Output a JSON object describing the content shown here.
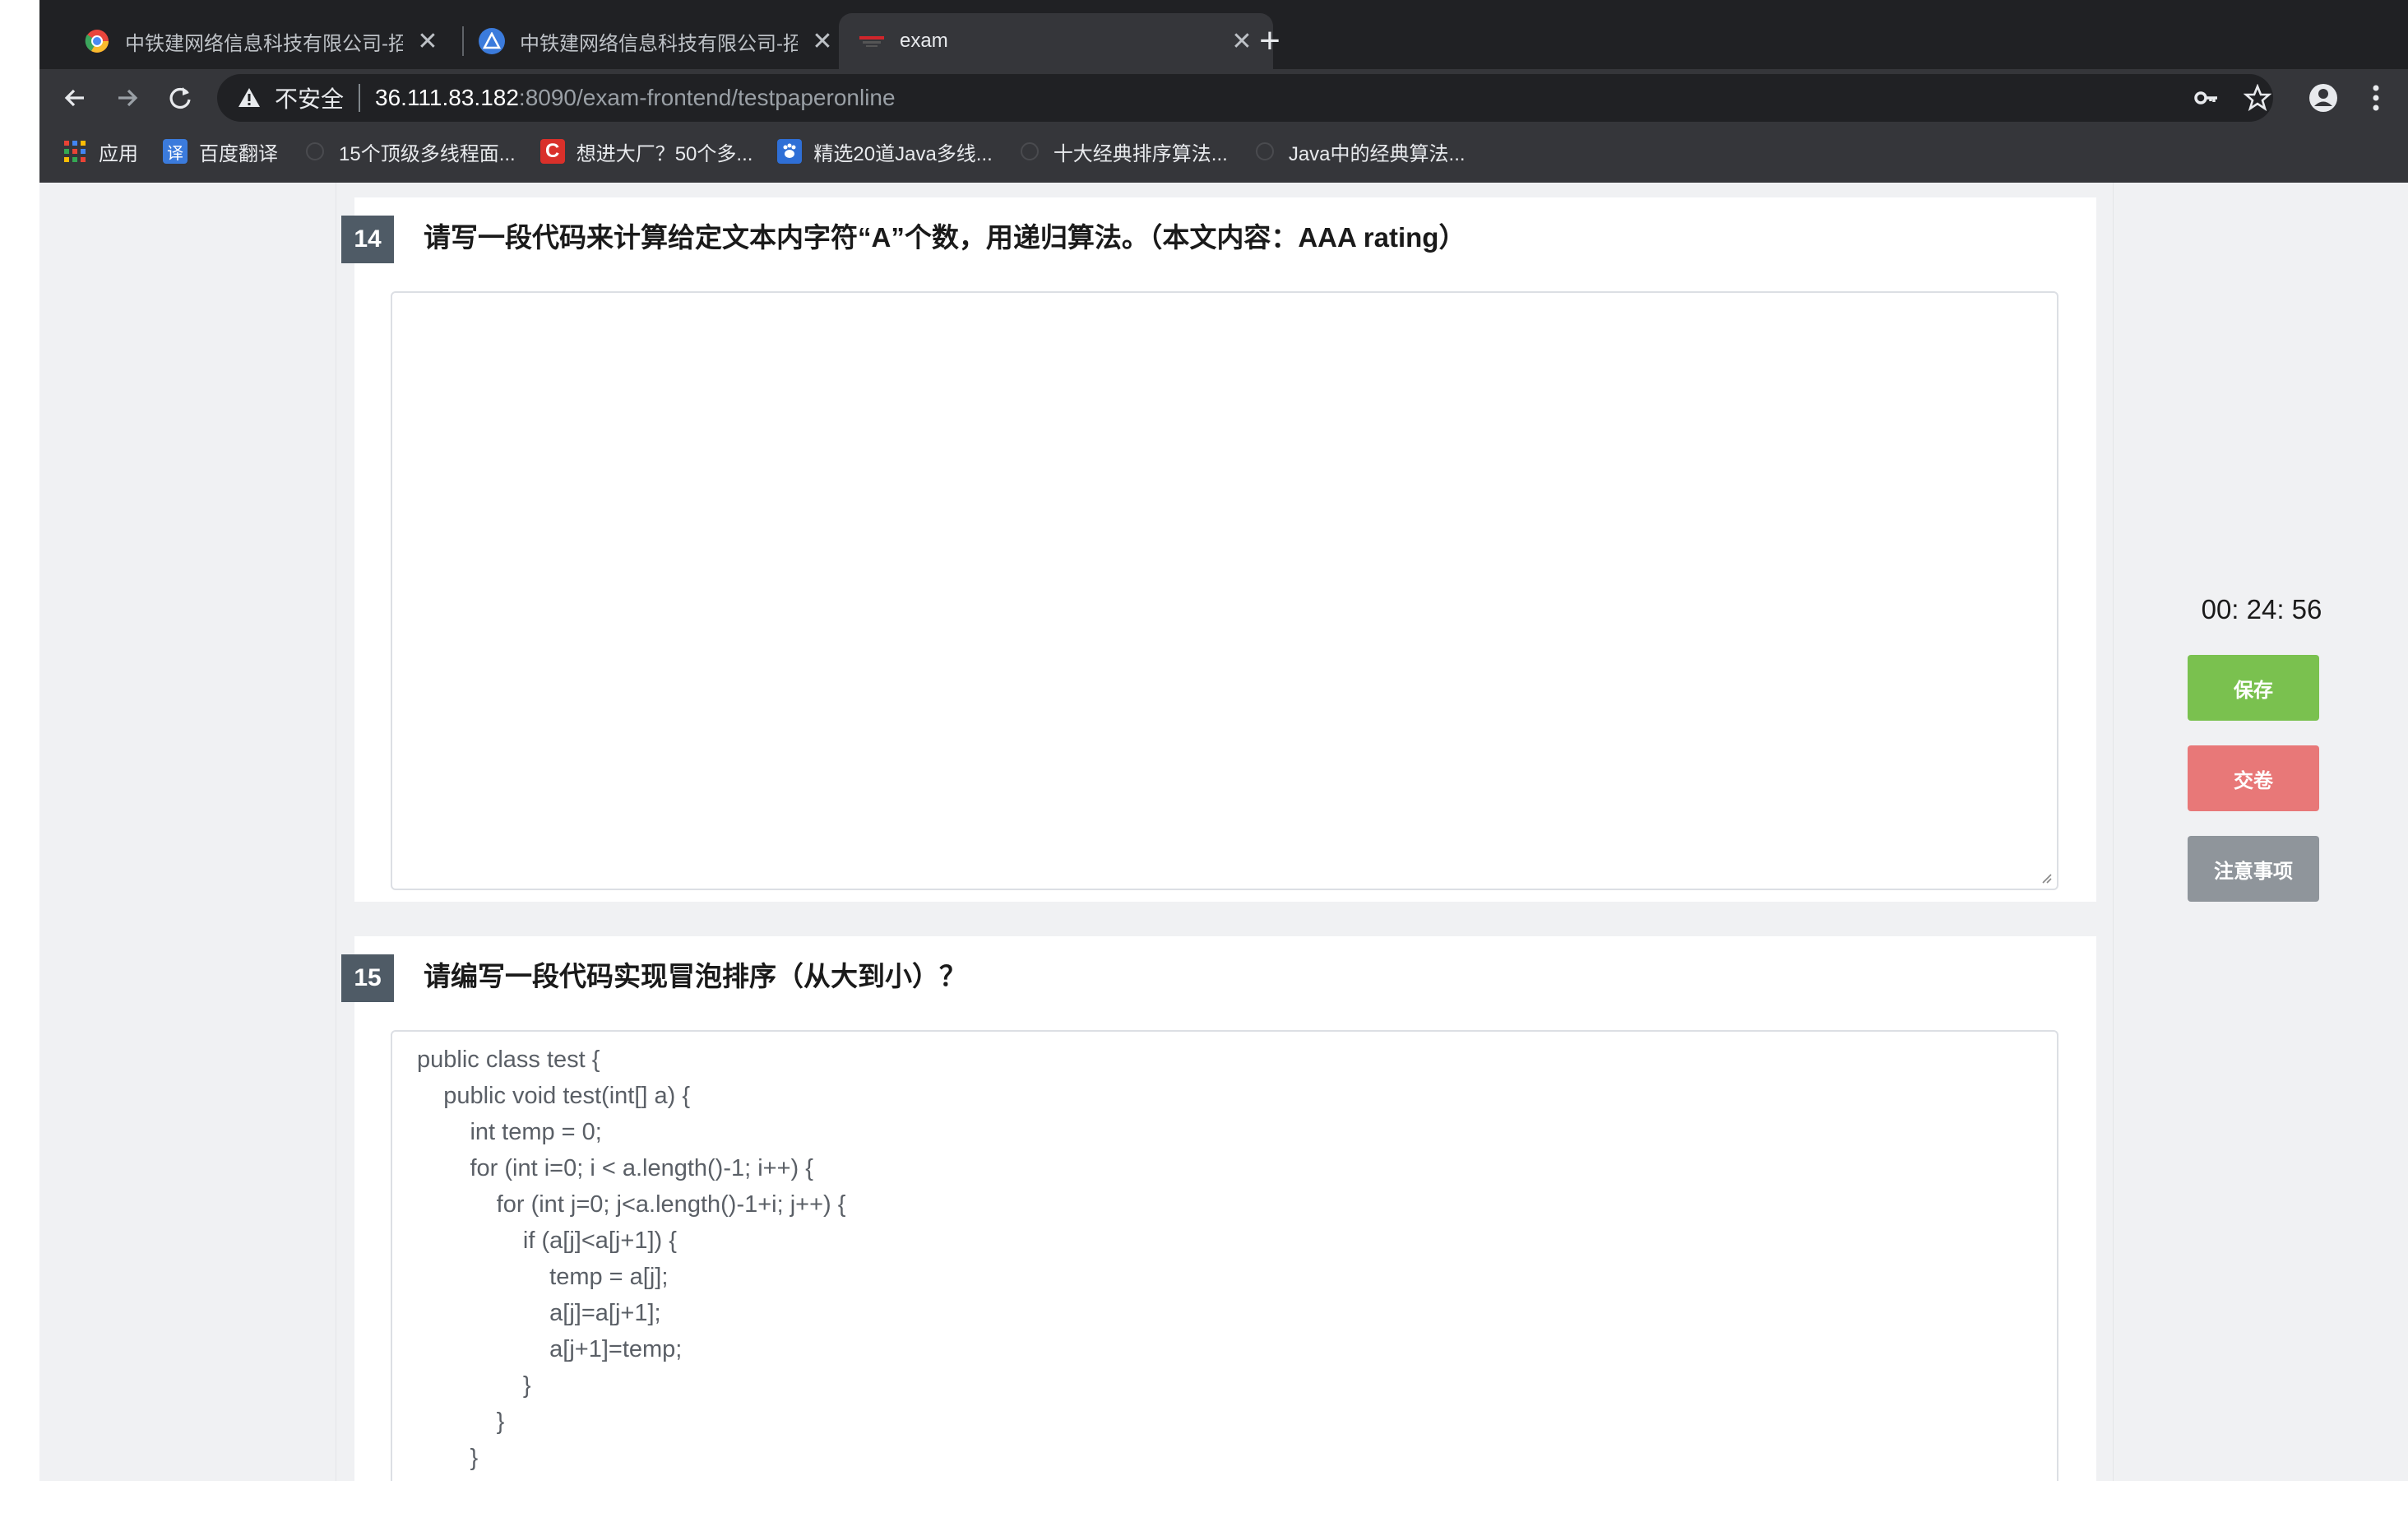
{
  "browser": {
    "tabs": [
      {
        "title": "中铁建网络信息科技有限公司-招",
        "active": false
      },
      {
        "title": "中铁建网络信息科技有限公司-招",
        "active": false
      },
      {
        "title": "exam",
        "active": true
      }
    ],
    "url": {
      "security_label": "不安全",
      "host": "36.111.83.182",
      "path": ":8090/exam-frontend/testpaperonline"
    },
    "bookmarks": [
      {
        "label": "应用",
        "icon": "apps-grid-icon"
      },
      {
        "label": "百度翻译",
        "icon": "translate-icon"
      },
      {
        "label": "15个顶级多线程面...",
        "icon": "site-icon"
      },
      {
        "label": "想进大厂？50个多...",
        "icon": "csdn-icon"
      },
      {
        "label": "精选20道Java多线...",
        "icon": "baidu-paw-icon"
      },
      {
        "label": "十大经典排序算法...",
        "icon": "site-icon"
      },
      {
        "label": "Java中的经典算法...",
        "icon": "site-icon"
      }
    ]
  },
  "exam": {
    "questions": [
      {
        "number": "14",
        "text": "请写一段代码来计算给定文本内字符“A”个数，用递归算法。（本文内容：AAA rating）",
        "answer": ""
      },
      {
        "number": "15",
        "text": "请编写一段代码实现冒泡排序（从大到小）？",
        "answer": "public class test {\n    public void test(int[] a) {\n        int temp = 0;\n        for (int i=0; i < a.length()-1; i++) {\n            for (int j=0; j<a.length()-1+i; j++) {\n                if (a[j]<a[j+1]) {\n                    temp = a[j];\n                    a[j]=a[j+1];\n                    a[j+1]=temp;\n                }\n            }\n        }"
      }
    ]
  },
  "sidebar": {
    "timer": "00: 24: 56",
    "save_label": "保存",
    "submit_label": "交卷",
    "notes_label": "注意事项"
  },
  "colors": {
    "save": "#7ac14f",
    "submit": "#e87878",
    "notes": "#8f959b",
    "question_badge": "#4f5b66"
  }
}
